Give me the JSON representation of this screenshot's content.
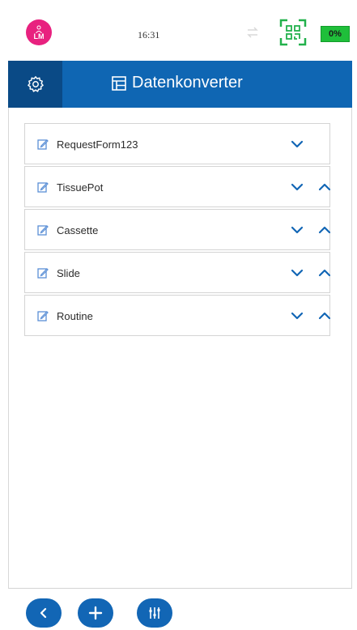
{
  "status_bar": {
    "user_initials": "LM",
    "time": "16:31",
    "battery": "0%"
  },
  "header": {
    "title": "Datenkonverter"
  },
  "list": {
    "items": [
      {
        "label": "RequestForm123",
        "has_up": false
      },
      {
        "label": "TissuePot",
        "has_up": true
      },
      {
        "label": "Cassette",
        "has_up": true
      },
      {
        "label": "Slide",
        "has_up": true
      },
      {
        "label": "Routine",
        "has_up": true
      }
    ]
  },
  "colors": {
    "header_bg": "#0f66b3",
    "settings_bg": "#0a4a86",
    "avatar": "#e8217f",
    "battery": "#1fbf3a",
    "accent": "#1266b5"
  },
  "icons": {
    "settings": "gear-icon",
    "title": "table-icon",
    "item": "edit-icon",
    "expand": "chevron-down-icon",
    "collapse": "chevron-up-icon",
    "back": "chevron-left-icon",
    "add": "plus-icon",
    "filter": "sliders-icon"
  }
}
